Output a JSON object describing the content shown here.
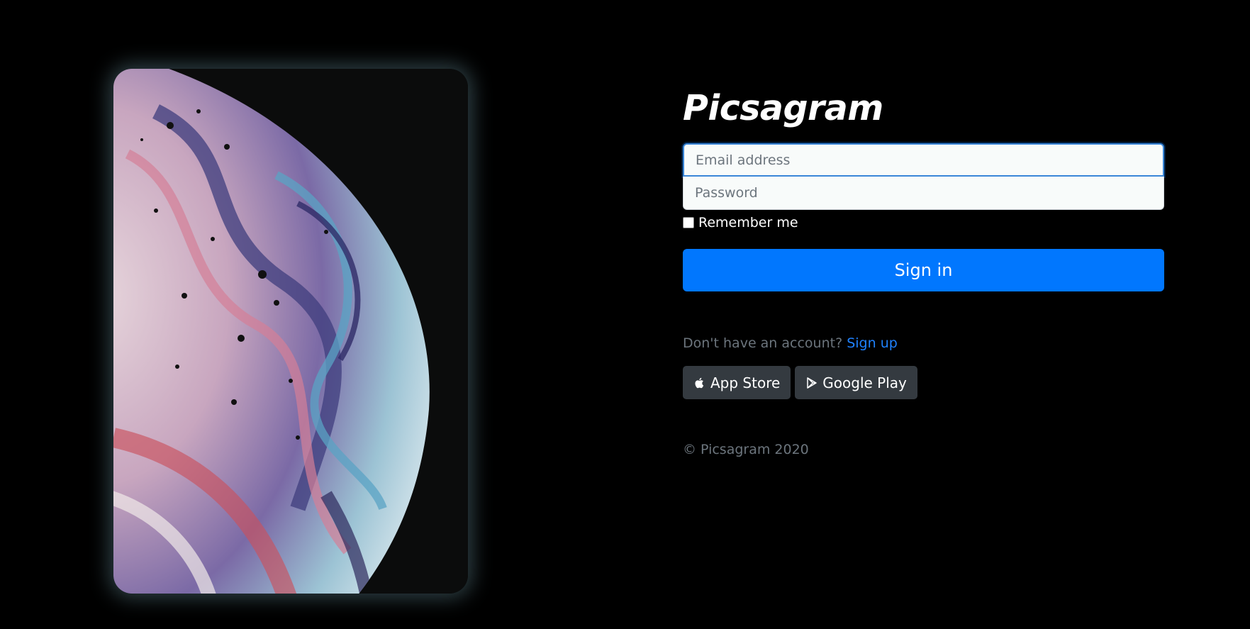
{
  "brand": {
    "name": "Picsagram"
  },
  "form": {
    "email_placeholder": "Email address",
    "password_placeholder": "Password",
    "remember_label": "Remember me",
    "submit_label": "Sign in"
  },
  "signup": {
    "prompt": "Don't have an account?",
    "link_label": "Sign up"
  },
  "stores": [
    {
      "label": "App Store",
      "icon": "apple-icon"
    },
    {
      "label": "Google Play",
      "icon": "google-play-icon"
    }
  ],
  "footer": {
    "copyright": "© Picsagram 2020"
  },
  "colors": {
    "background": "#000000",
    "primary": "#0177fe",
    "link": "#1f82ff",
    "store_button": "#343a40",
    "muted_text": "#6c757d"
  }
}
